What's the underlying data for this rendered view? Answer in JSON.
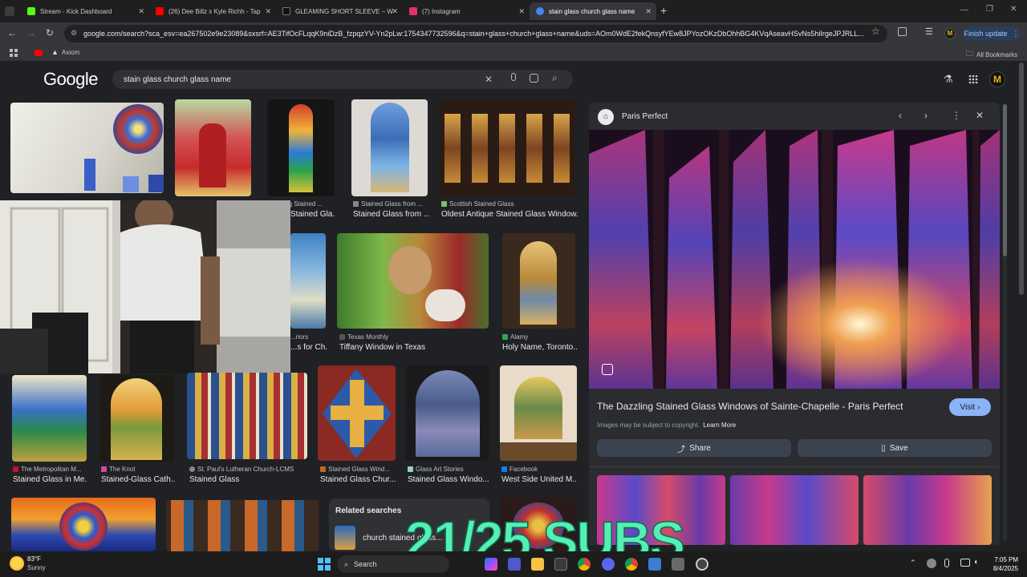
{
  "browser": {
    "tabs": [
      {
        "label": "Stream - Kick Dashboard",
        "icon": "kick-icon",
        "color": "#53fc18"
      },
      {
        "label": "(26) Dee Billz x Kyle Richh - Tap",
        "icon": "youtube-icon",
        "color": "#ff0000"
      },
      {
        "label": "GLEAMING SHORT SLEEVE – W",
        "icon": "store-icon",
        "color": "#111111"
      },
      {
        "label": "(7) Instagram",
        "icon": "instagram-icon",
        "color": "#e1306c"
      },
      {
        "label": "stain glass church glass name",
        "icon": "google-icon",
        "color": "#4285f4"
      }
    ],
    "new_tab": "+",
    "url": "google.com/search?sca_esv=ea267502e9e23089&sxsrf=AE3TifOcFLqqK9niDzB_fzpqzYV-Yn2pLw:1754347732596&q=stain+glass+church+glass+name&uds=AOm0WdE2fekQnsyfYEw8JPYozOKzDbOhhBG4KVqAseavHSvNs5hiIrgeJPJRLL...",
    "finish_update": "Finish update",
    "profile_initial": "M",
    "bookmark_item": "Axiom",
    "all_bookmarks": "All Bookmarks"
  },
  "google": {
    "logo": "Google",
    "query": "stain glass church glass name",
    "avatar_initial": "M"
  },
  "results": {
    "row1": [
      {
        "source": "",
        "title": ""
      },
      {
        "source": "",
        "title": ""
      },
      {
        "source": "...thing Stained ...",
        "title": "Stained Gla..."
      },
      {
        "source": "Stained Glass from ...",
        "title": "Stained Glass from ..."
      },
      {
        "source": "Scottish Stained Glass",
        "title": "Oldest Antique Stained Glass Window..."
      }
    ],
    "row2": [
      {
        "source": "...riors",
        "title": "...s for Ch..."
      },
      {
        "source": "Texas Monthly",
        "title": "Tiffany Window in Texas"
      },
      {
        "source": "Alamy",
        "title": "Holy Name, Toronto..."
      }
    ],
    "row3": [
      {
        "source": "The Metropolitan M...",
        "title": "Stained Glass in Me..."
      },
      {
        "source": "The Knot",
        "title": "Stained-Glass Cath..."
      },
      {
        "source": "St. Paul's Lutheran Church-LCMS",
        "title": "Stained Glass"
      },
      {
        "source": "Stained Glass Wind...",
        "title": "Stained Glass Chur..."
      },
      {
        "source": "Glass Art Stories",
        "title": "Stained Glass Windo..."
      },
      {
        "source": "Facebook",
        "title": "West Side United M..."
      }
    ],
    "related_header": "Related searches",
    "related_item": "church stained glass..."
  },
  "panel": {
    "site": "Paris Perfect",
    "title": "The Dazzling Stained Glass Windows of Sainte-Chapelle - Paris Perfect",
    "visit": "Visit",
    "copyright": "Images may be subject to copyright.",
    "learn_more": "Learn More",
    "share": "Share",
    "save": "Save"
  },
  "overlay": {
    "subs": "21/25 SUBS"
  },
  "taskbar": {
    "temp": "83°F",
    "weather": "Sunny",
    "search": "Search",
    "time": "7:05 PM",
    "date": "8/4/2025"
  },
  "colors": {
    "page_bg": "#202124",
    "accent": "#8ab4f8",
    "overlay": "#55efb4"
  }
}
